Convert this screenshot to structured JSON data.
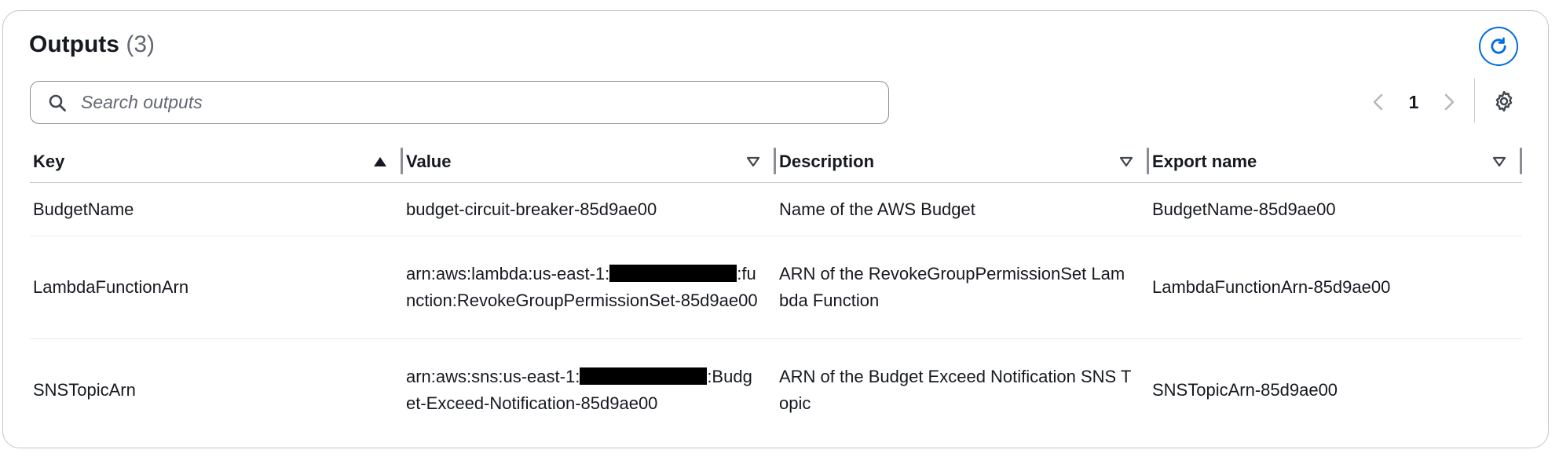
{
  "header": {
    "title": "Outputs",
    "count": "(3)"
  },
  "search": {
    "placeholder": "Search outputs",
    "value": ""
  },
  "pagination": {
    "current_page": "1"
  },
  "table": {
    "columns": [
      {
        "label": "Key",
        "sort": "ascending"
      },
      {
        "label": "Value",
        "sort": "none"
      },
      {
        "label": "Description",
        "sort": "none"
      },
      {
        "label": "Export name",
        "sort": "none"
      }
    ],
    "rows": [
      {
        "key": "BudgetName",
        "value": "budget-circuit-breaker-85d9ae00",
        "description": "Name of the AWS Budget",
        "export_name": "BudgetName-85d9ae00"
      },
      {
        "key": "LambdaFunctionArn",
        "value_prefix": "arn:aws:lambda:us-east-1:",
        "value_suffix": ":function:RevokeGroupPermissionSet-85d9ae00",
        "description": "ARN of the RevokeGroupPermissionSet Lambda Function",
        "export_name": "LambdaFunctionArn-85d9ae00"
      },
      {
        "key": "SNSTopicArn",
        "value_prefix": "arn:aws:sns:us-east-1:",
        "value_suffix": ":Budget-Exceed-Notification-85d9ae00",
        "description": "ARN of the Budget Exceed Notification SNS Topic",
        "export_name": "SNSTopicArn-85d9ae00"
      }
    ]
  },
  "icons": {
    "refresh": "refresh-icon",
    "search": "search-icon",
    "prev": "chevron-left-icon",
    "next": "chevron-right-icon",
    "settings": "gear-icon",
    "sort_asc": "caret-up-filled-icon",
    "sort_none": "caret-down-outline-icon"
  },
  "colors": {
    "accent": "#006ce0",
    "text": "#16191f",
    "muted": "#656871",
    "border": "#c6c6cd"
  }
}
